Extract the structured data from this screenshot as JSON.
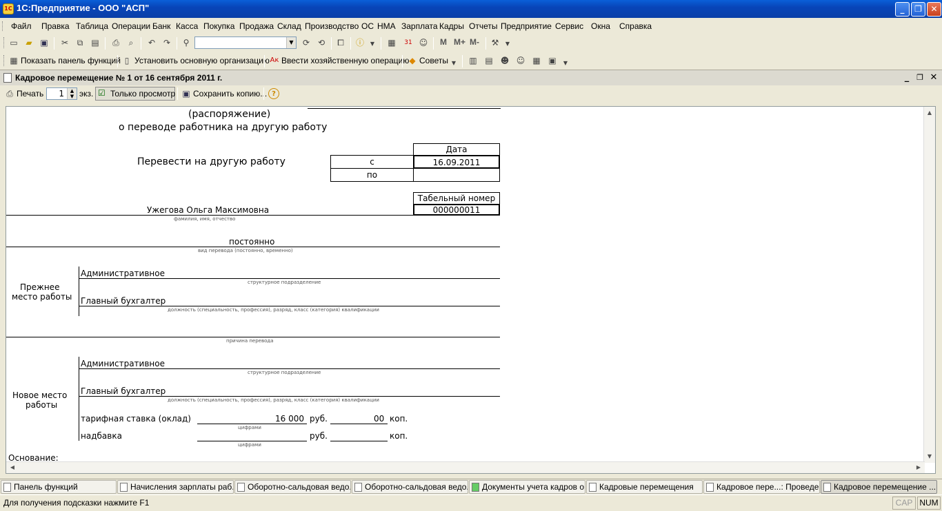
{
  "window": {
    "title": "1С:Предприятие - ООО \"АСП\"",
    "app_icon": "1С"
  },
  "menu": [
    "Файл",
    "Правка",
    "Таблица",
    "Операции",
    "Банк",
    "Касса",
    "Покупка",
    "Продажа",
    "Склад",
    "Производство",
    "ОС",
    "НМА",
    "Зарплата",
    "Кадры",
    "Отчеты",
    "Предприятие",
    "Сервис",
    "Окна",
    "Справка"
  ],
  "toolbar2": {
    "show_panel": "Показать панель функций",
    "set_org": "Установить основную организацию",
    "enter_op": "Ввести хозяйственную операцию",
    "tips": "Советы",
    "m_buttons": [
      "M",
      "M+",
      "M-"
    ]
  },
  "document": {
    "title": "Кадровое перемещение  № 1 от 16 сентября 2011 г.",
    "toolbar": {
      "print": "Печать",
      "copies": "1",
      "copies_unit": "экз.",
      "readonly": "Только просмотр",
      "save_copy": "Сохранить копию..."
    }
  },
  "report": {
    "heading1": "(распоряжение)",
    "heading2": "о переводе работника на другую работу",
    "transfer_label": "Перевести на другую работу",
    "date_header": "Дата",
    "from_label": "с",
    "from_value": "16.09.2011",
    "to_label": "по",
    "to_value": "",
    "tabnum_header": "Табельный номер",
    "tabnum_value": "000000011",
    "employee": "Ужегова Ольга Максимовна",
    "employee_hint": "фамилия, имя, отчество",
    "transfer_type": "постоянно",
    "transfer_type_hint": "вид перевода (постоянно, временно)",
    "prev_label_1": "Прежнее",
    "prev_label_2": "место работы",
    "prev_dept": "Административное",
    "dept_hint": "структурное подразделение",
    "prev_position": "Главный бухгалтер",
    "position_hint": "должность (специальность, профессия), разряд, класс (категория) квалификации",
    "reason_hint": "причина перевода",
    "new_label_1": "Новое место",
    "new_label_2": "работы",
    "new_dept": "Административное",
    "new_position": "Главный бухгалтер",
    "rate_label": "тарифная ставка (оклад)",
    "rate_value": "16 000",
    "rub": "руб.",
    "kop_value": "00",
    "kop": "коп.",
    "digits_hint": "цифрами",
    "allowance_label": "надбавка",
    "basis_label": "Основание:"
  },
  "taskbar": [
    {
      "label": "Панель функций",
      "active": false
    },
    {
      "label": "Начисления зарплаты раб...",
      "active": false
    },
    {
      "label": "Оборотно-сальдовая ведо...",
      "active": false
    },
    {
      "label": "Оборотно-сальдовая ведо...",
      "active": false
    },
    {
      "label": "Документы учета кадров о...",
      "active": false
    },
    {
      "label": "Кадровые перемещения",
      "active": false
    },
    {
      "label": "Кадровое пере...: Проведен",
      "active": false
    },
    {
      "label": "Кадровое перемещение  ...",
      "active": true
    }
  ],
  "status": {
    "hint": "Для получения подсказки нажмите F1",
    "cap": "CAP",
    "num": "NUM"
  }
}
